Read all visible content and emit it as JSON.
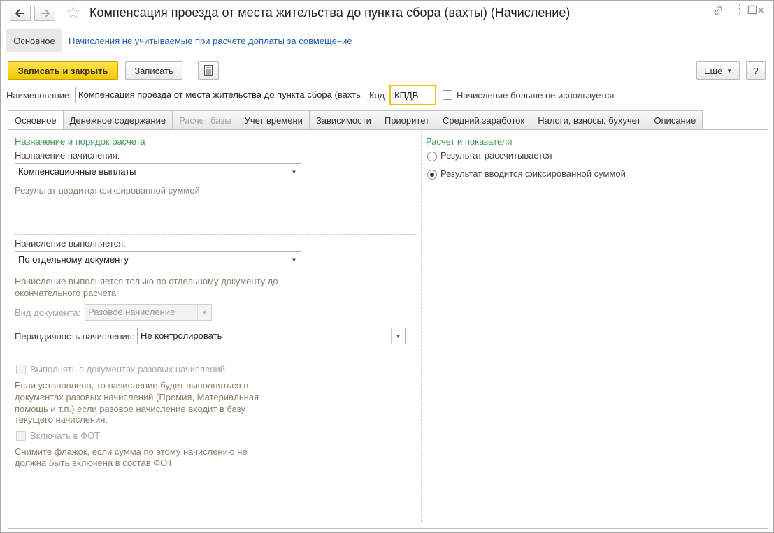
{
  "window": {
    "title": "Компенсация проезда от места жительства до пункта сбора (вахты) (Начисление)"
  },
  "top_sections": {
    "main": "Основное",
    "link": "Начисления не учитываемые при расчете доплаты за совмещение"
  },
  "toolbar": {
    "save_close": "Записать и закрыть",
    "save": "Записать",
    "more": "Еще",
    "help": "?"
  },
  "header": {
    "name_label": "Наименование:",
    "name_value": "Компенсация проезда от места жительства до пункта сбора (вахты)",
    "code_label": "Код:",
    "code_value": "КПДВ",
    "unused_label": "Начисление больше не используется"
  },
  "tabs": [
    {
      "label": "Основное"
    },
    {
      "label": "Денежное содержание"
    },
    {
      "label": "Расчет базы"
    },
    {
      "label": "Учет времени"
    },
    {
      "label": "Зависимости"
    },
    {
      "label": "Приоритет"
    },
    {
      "label": "Средний заработок"
    },
    {
      "label": "Налоги, взносы, бухучет"
    },
    {
      "label": "Описание"
    }
  ],
  "left": {
    "section_title": "Назначение и порядок расчета",
    "purpose_label": "Назначение начисления:",
    "purpose_value": "Компенсационные выплаты",
    "purpose_hint": "Результат вводится фиксированной суммой",
    "exec_label": "Начисление выполняется:",
    "exec_value": "По отдельному документу",
    "exec_hint_1": "Начисление выполняется только по отдельному документу до",
    "exec_hint_2": "окончательного расчета",
    "doc_type_label": "Вид документа:",
    "doc_type_value": "Разовое начисление",
    "period_label": "Периодичность начисления:",
    "period_value": "Не контролировать",
    "one_time_label": "Выполнять в документах разовых начислений",
    "one_time_hint_1": "Если установлено, то начисление будет выполняться в",
    "one_time_hint_2": "документах разовых начислений (Премия, Материальная",
    "one_time_hint_3": "помощь и т.п.) если разовое начисление входит в базу",
    "one_time_hint_4": "текущего начисления.",
    "fot_label": "Включать в ФОТ",
    "fot_hint_1": "Снимите флажок, если сумма по этому начислению не",
    "fot_hint_2": "должна быть включена в состав ФОТ"
  },
  "right": {
    "section_title": "Расчет и показатели",
    "radio_1": "Результат рассчитывается",
    "radio_2": "Результат вводится фиксированной суммой"
  }
}
